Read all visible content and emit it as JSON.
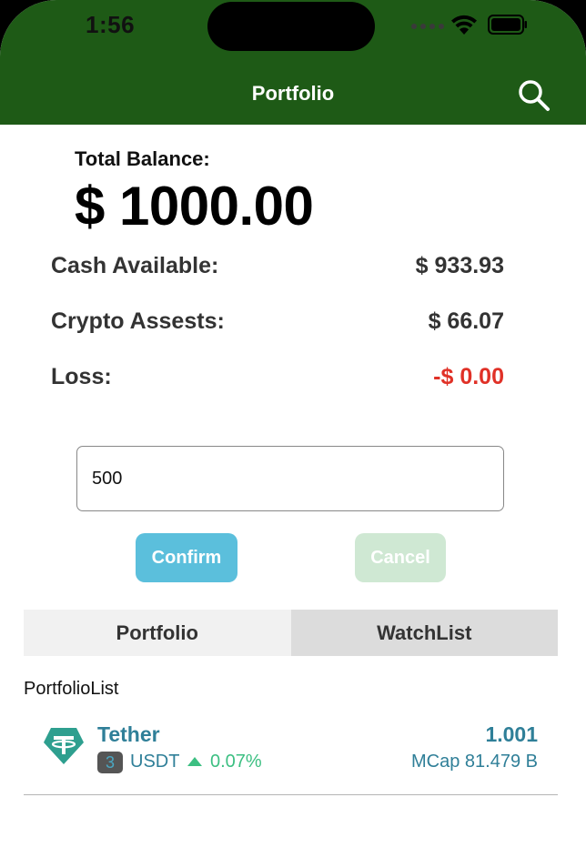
{
  "status_bar": {
    "time": "1:56"
  },
  "navbar": {
    "title": "Portfolio"
  },
  "balance": {
    "total_label": "Total Balance:",
    "total_value": "$ 1000.00",
    "rows": [
      {
        "label": "Cash Available:",
        "value": "$ 933.93"
      },
      {
        "label": "Crypto Assests:",
        "value": "$ 66.07"
      },
      {
        "label": "Loss:",
        "value": "-$ 0.00"
      }
    ]
  },
  "amount_input": {
    "value": "500"
  },
  "buttons": {
    "confirm": "Confirm",
    "cancel": "Cancel"
  },
  "tabs": [
    {
      "label": "Portfolio",
      "selected": false
    },
    {
      "label": "WatchList",
      "selected": true
    }
  ],
  "list": {
    "header": "PortfolioList",
    "items": [
      {
        "name": "Tether",
        "rank": "3",
        "symbol": "USDT",
        "change": "0.07%",
        "change_direction": "up",
        "price": "1.001",
        "market_cap": "MCap 81.479 B",
        "icon": "tether-icon"
      }
    ]
  },
  "colors": {
    "header_green": "#1e5a16",
    "loss_red": "#e03127",
    "confirm_blue": "#5bbfdc",
    "cancel_green_disabled": "#cfe8d3",
    "accent_teal": "#2f7f98",
    "up_green": "#3cbf82"
  }
}
